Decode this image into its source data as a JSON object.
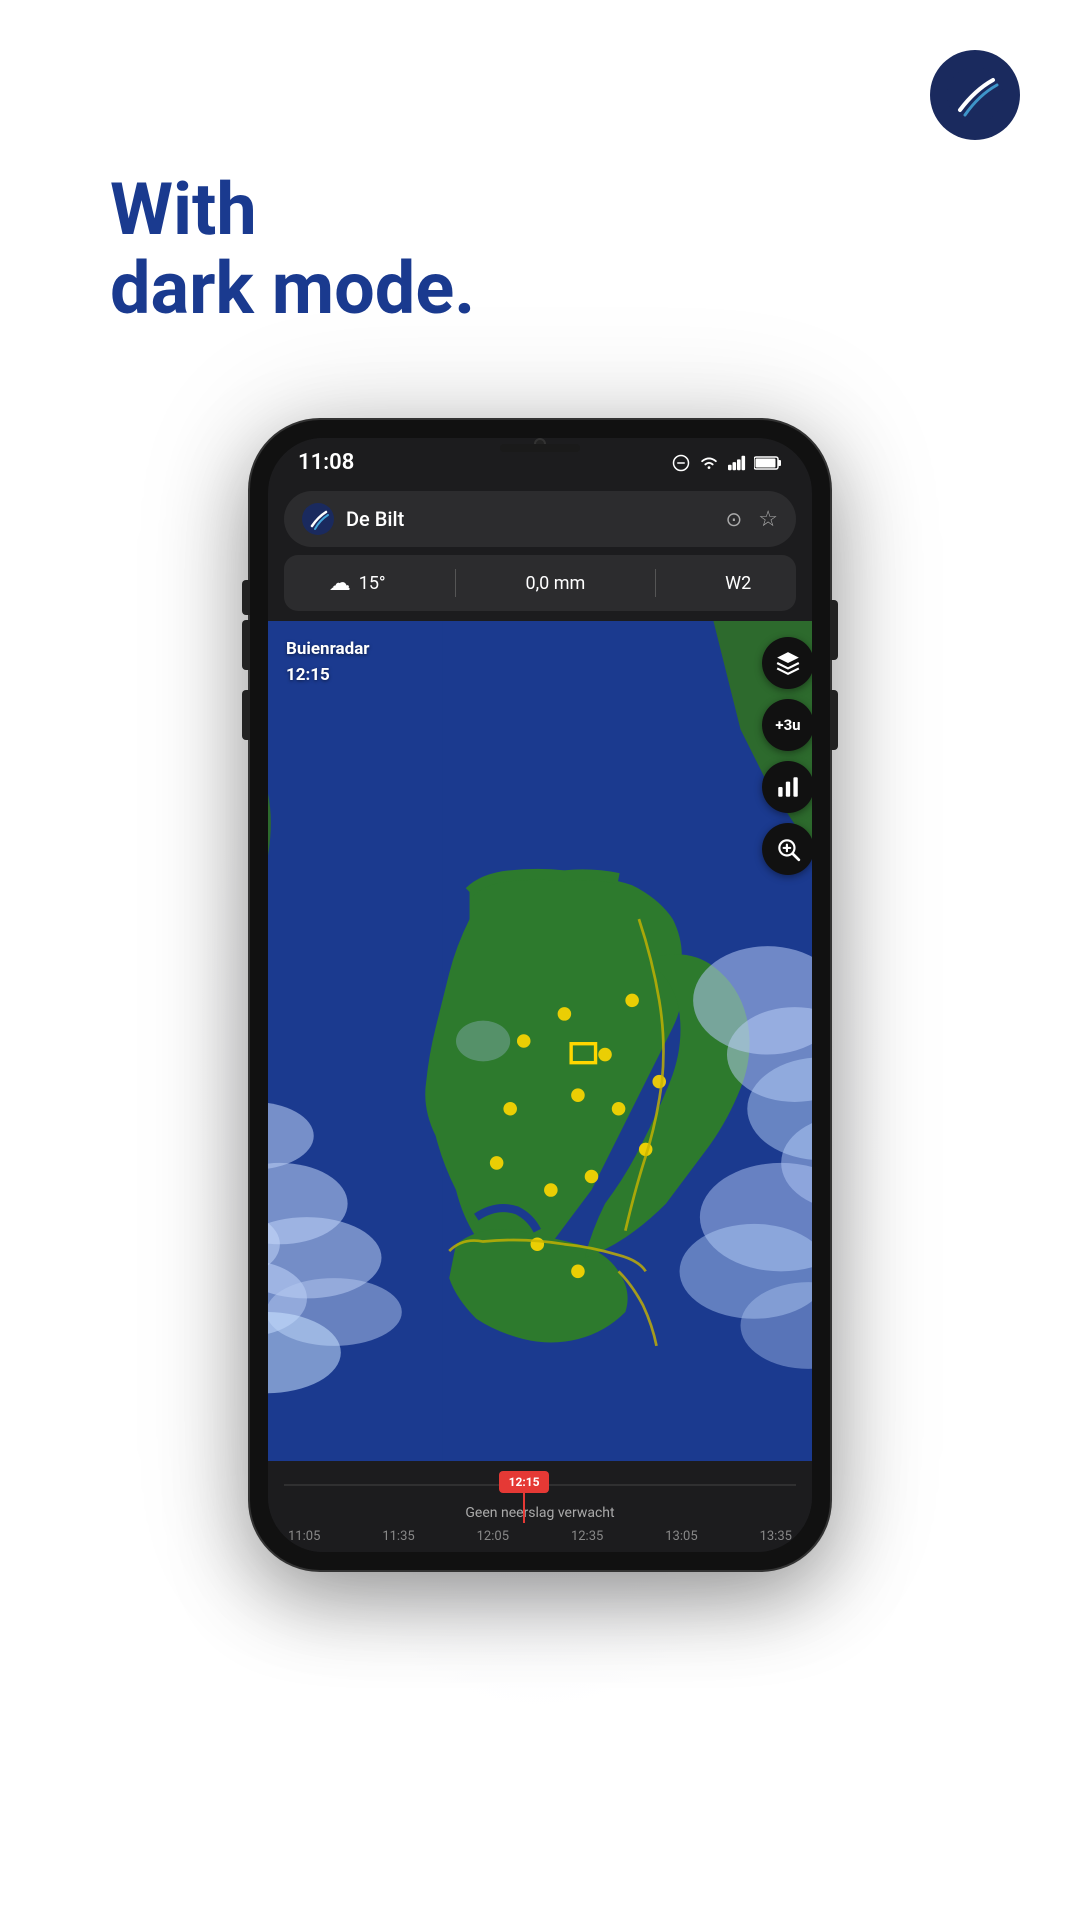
{
  "logo": {
    "alt": "Buienradar app logo"
  },
  "headline": {
    "line1": "With",
    "line2": "dark mode."
  },
  "phone": {
    "status_bar": {
      "time": "11:08",
      "icons": [
        "do-not-disturb",
        "wifi",
        "signal",
        "battery"
      ]
    },
    "location_bar": {
      "city": "De Bilt",
      "gps_icon": "⊙",
      "star_icon": "☆"
    },
    "weather_stats": {
      "icon": "☁",
      "temperature": "15°",
      "precipitation": "0,0 mm",
      "wind": "W2"
    },
    "map": {
      "radar_label": "Buienradar",
      "time_label": "12:15",
      "buttons": [
        {
          "id": "layers",
          "label": "layers"
        },
        {
          "id": "time-offset",
          "label": "+3u"
        },
        {
          "id": "chart",
          "label": "chart"
        },
        {
          "id": "zoom",
          "label": "zoom"
        }
      ]
    },
    "timeline": {
      "current_time": "12:15",
      "status_text": "Geen neerslag verwacht",
      "time_labels": [
        "11:05",
        "11:35",
        "12:05",
        "12:35",
        "13:05",
        "13:35"
      ]
    }
  }
}
